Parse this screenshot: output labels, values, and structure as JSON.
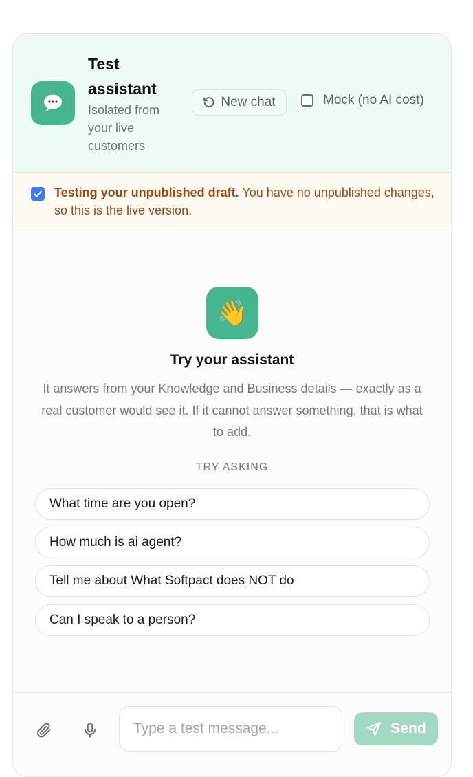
{
  "header": {
    "title": "Test assistant",
    "subtitle": "Isolated from your live customers",
    "avatar_icon": "chat-bubble-icon",
    "new_chat_label": "New chat",
    "mock_label": "Mock (no AI cost)",
    "mock_checked": false,
    "accent_color": "#45b68f"
  },
  "notice": {
    "checked": true,
    "strong": "Testing your unpublished draft.",
    "text": "You have no unpublished changes, so this is the live version.",
    "text_color": "#9a4a13"
  },
  "welcome": {
    "icon": "👋",
    "title": "Try your assistant",
    "description": "It answers from your Knowledge and Business details — exactly as a real customer would see it. If it cannot answer something, that is what to add."
  },
  "suggestions": {
    "label": "TRY ASKING",
    "items": [
      "What time are you open?",
      "How much is ai agent?",
      "Tell me about What Softpact does NOT do",
      "Can I speak to a person?"
    ]
  },
  "composer": {
    "placeholder": "Type a test message...",
    "value": "",
    "send_label": "Send",
    "attach_icon": "paperclip-icon",
    "mic_icon": "microphone-icon",
    "send_icon": "send-icon"
  }
}
